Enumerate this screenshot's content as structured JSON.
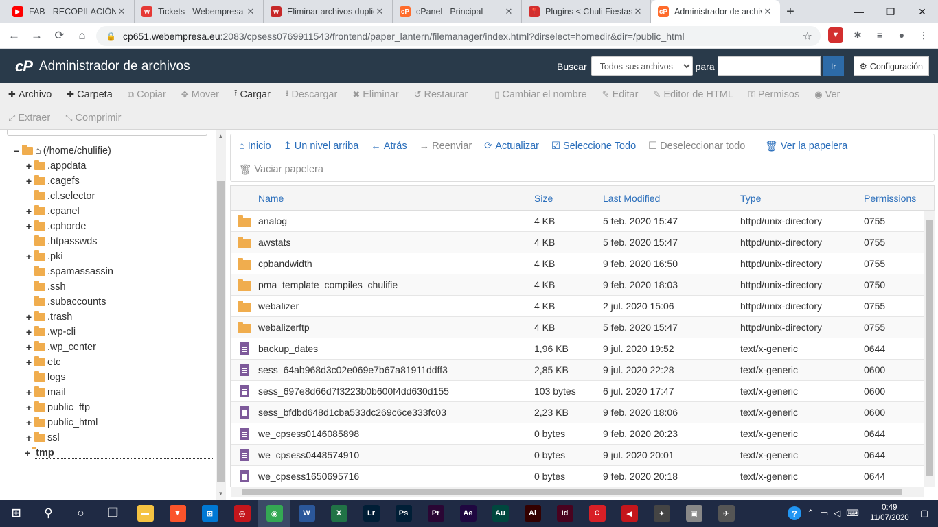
{
  "browser": {
    "tabs": [
      {
        "title": "FAB - RECOPILACIÓN -",
        "favicon": "youtube-icon",
        "color": "#ff0000",
        "glyph": "▶"
      },
      {
        "title": "Tickets - Webempresa E",
        "favicon": "webempresa-icon",
        "color": "#e53935",
        "glyph": "w"
      },
      {
        "title": "Eliminar archivos duplic",
        "favicon": "webempresa-icon",
        "color": "#c62828",
        "glyph": "w"
      },
      {
        "title": "cPanel - Principal",
        "favicon": "cpanel-icon",
        "color": "#ff6c2c",
        "glyph": "cP"
      },
      {
        "title": "Plugins < Chuli Fiestas",
        "favicon": "pin-icon",
        "color": "#d32f2f",
        "glyph": "📍"
      },
      {
        "title": "Administrador de archiv",
        "favicon": "cpanel-icon",
        "color": "#ff6c2c",
        "glyph": "cP"
      }
    ],
    "url_host": "cp651.webempresa.eu",
    "url_path": ":2083/cpsess0769911543/frontend/paper_lantern/filemanager/index.html?dirselect=homedir&dir=/public_html"
  },
  "header": {
    "logo": "cP",
    "title": "Administrador de archivos",
    "search_label": "Buscar",
    "search_scope": "Todos sus archivos",
    "para_label": "para",
    "go_label": "Ir",
    "config_label": "Configuración"
  },
  "toolbar": {
    "row1": [
      {
        "label": "Archivo",
        "icon": "plus-icon",
        "glyph": "✚",
        "enabled": true
      },
      {
        "label": "Carpeta",
        "icon": "plus-icon",
        "glyph": "✚",
        "enabled": true
      },
      {
        "label": "Copiar",
        "icon": "copy-icon",
        "glyph": "⧉",
        "enabled": false
      },
      {
        "label": "Mover",
        "icon": "move-icon",
        "glyph": "✥",
        "enabled": false
      },
      {
        "label": "Cargar",
        "icon": "upload-icon",
        "glyph": "⭱",
        "enabled": true
      },
      {
        "label": "Descargar",
        "icon": "download-icon",
        "glyph": "⭳",
        "enabled": false
      },
      {
        "label": "Eliminar",
        "icon": "delete-icon",
        "glyph": "✖",
        "enabled": false
      },
      {
        "label": "Restaurar",
        "icon": "restore-icon",
        "glyph": "↺",
        "enabled": false
      },
      {
        "sep": true
      },
      {
        "label": "Cambiar el nombre",
        "icon": "rename-icon",
        "glyph": "▯",
        "enabled": false
      },
      {
        "label": "Editar",
        "icon": "pencil-icon",
        "glyph": "✎",
        "enabled": false
      },
      {
        "label": "Editor de HTML",
        "icon": "html-editor-icon",
        "glyph": "✎",
        "enabled": false
      },
      {
        "label": "Permisos",
        "icon": "key-icon",
        "glyph": "⚿",
        "enabled": false
      },
      {
        "label": "Ver",
        "icon": "eye-icon",
        "glyph": "◉",
        "enabled": false
      }
    ],
    "row2": [
      {
        "label": "Extraer",
        "icon": "expand-icon",
        "glyph": "⤢",
        "enabled": false
      },
      {
        "label": "Comprimir",
        "icon": "compress-icon",
        "glyph": "⤡",
        "enabled": false
      }
    ]
  },
  "tree": {
    "root": "(/home/chulifie)",
    "items": [
      {
        "label": ".appdata",
        "expandable": true
      },
      {
        "label": ".cagefs",
        "expandable": true
      },
      {
        "label": ".cl.selector",
        "expandable": false
      },
      {
        "label": ".cpanel",
        "expandable": true
      },
      {
        "label": ".cphorde",
        "expandable": true
      },
      {
        "label": ".htpasswds",
        "expandable": false
      },
      {
        "label": ".pki",
        "expandable": true
      },
      {
        "label": ".spamassassin",
        "expandable": false
      },
      {
        "label": ".ssh",
        "expandable": false
      },
      {
        "label": ".subaccounts",
        "expandable": false
      },
      {
        "label": ".trash",
        "expandable": true
      },
      {
        "label": ".wp-cli",
        "expandable": true
      },
      {
        "label": ".wp_center",
        "expandable": true
      },
      {
        "label": "etc",
        "expandable": true
      },
      {
        "label": "logs",
        "expandable": false
      },
      {
        "label": "mail",
        "expandable": true
      },
      {
        "label": "public_ftp",
        "expandable": true
      },
      {
        "label": "public_html",
        "expandable": true
      },
      {
        "label": "ssl",
        "expandable": true
      },
      {
        "label": "tmp",
        "expandable": true,
        "selected": true
      }
    ]
  },
  "nav": {
    "row1": [
      {
        "label": "Inicio",
        "icon": "home-icon",
        "glyph": "⌂",
        "enabled": true
      },
      {
        "label": "Un nivel arriba",
        "icon": "level-up-icon",
        "glyph": "↥",
        "enabled": true
      },
      {
        "label": "Atrás",
        "icon": "back-arrow-icon",
        "glyph": "←",
        "enabled": true
      },
      {
        "label": "Reenviar",
        "icon": "forward-arrow-icon",
        "glyph": "→",
        "enabled": false
      },
      {
        "label": "Actualizar",
        "icon": "refresh-icon",
        "glyph": "⟳",
        "enabled": true
      },
      {
        "label": "Seleccione Todo",
        "icon": "checkbox-checked-icon",
        "glyph": "☑",
        "enabled": true
      },
      {
        "label": "Deseleccionar todo",
        "icon": "checkbox-empty-icon",
        "glyph": "☐",
        "enabled": false
      },
      {
        "sep": true
      },
      {
        "label": "Ver la papelera",
        "icon": "trash-icon",
        "glyph": "🗑",
        "enabled": true
      }
    ],
    "row2": [
      {
        "label": "Vaciar papelera",
        "icon": "trash-icon",
        "glyph": "🗑",
        "enabled": false
      }
    ]
  },
  "table": {
    "headers": {
      "name": "Name",
      "size": "Size",
      "modified": "Last Modified",
      "type": "Type",
      "perms": "Permissions"
    },
    "rows": [
      {
        "kind": "dir",
        "name": "analog",
        "size": "4 KB",
        "modified": "5 feb. 2020 15:47",
        "type": "httpd/unix-directory",
        "perms": "0755"
      },
      {
        "kind": "dir",
        "name": "awstats",
        "size": "4 KB",
        "modified": "5 feb. 2020 15:47",
        "type": "httpd/unix-directory",
        "perms": "0755"
      },
      {
        "kind": "dir",
        "name": "cpbandwidth",
        "size": "4 KB",
        "modified": "9 feb. 2020 16:50",
        "type": "httpd/unix-directory",
        "perms": "0755"
      },
      {
        "kind": "dir",
        "name": "pma_template_compiles_chulifie",
        "size": "4 KB",
        "modified": "9 feb. 2020 18:03",
        "type": "httpd/unix-directory",
        "perms": "0750"
      },
      {
        "kind": "dir",
        "name": "webalizer",
        "size": "4 KB",
        "modified": "2 jul. 2020 15:06",
        "type": "httpd/unix-directory",
        "perms": "0755"
      },
      {
        "kind": "dir",
        "name": "webalizerftp",
        "size": "4 KB",
        "modified": "5 feb. 2020 15:47",
        "type": "httpd/unix-directory",
        "perms": "0755"
      },
      {
        "kind": "file",
        "name": "backup_dates",
        "size": "1,96 KB",
        "modified": "9 jul. 2020 19:52",
        "type": "text/x-generic",
        "perms": "0644"
      },
      {
        "kind": "file",
        "name": "sess_64ab968d3c02e069e7b67a81911ddff3",
        "size": "2,85 KB",
        "modified": "9 jul. 2020 22:28",
        "type": "text/x-generic",
        "perms": "0600"
      },
      {
        "kind": "file",
        "name": "sess_697e8d66d7f3223b0b600f4dd630d155",
        "size": "103 bytes",
        "modified": "6 jul. 2020 17:47",
        "type": "text/x-generic",
        "perms": "0600"
      },
      {
        "kind": "file",
        "name": "sess_bfdbd648d1cba533dc269c6ce333fc03",
        "size": "2,23 KB",
        "modified": "9 feb. 2020 18:06",
        "type": "text/x-generic",
        "perms": "0600"
      },
      {
        "kind": "file",
        "name": "we_cpsess0146085898",
        "size": "0 bytes",
        "modified": "9 feb. 2020 20:23",
        "type": "text/x-generic",
        "perms": "0644"
      },
      {
        "kind": "file",
        "name": "we_cpsess0448574910",
        "size": "0 bytes",
        "modified": "9 jul. 2020 20:01",
        "type": "text/x-generic",
        "perms": "0644"
      },
      {
        "kind": "file",
        "name": "we_cpsess1650695716",
        "size": "0 bytes",
        "modified": "9 feb. 2020 20:18",
        "type": "text/x-generic",
        "perms": "0644"
      }
    ]
  },
  "taskbar": {
    "apps": [
      {
        "name": "windows-start-icon",
        "glyph": "⊞",
        "color": "transparent"
      },
      {
        "name": "search-icon",
        "glyph": "⚲",
        "color": "transparent"
      },
      {
        "name": "cortana-icon",
        "glyph": "○",
        "color": "transparent"
      },
      {
        "name": "task-view-icon",
        "glyph": "❐",
        "color": "transparent"
      },
      {
        "name": "file-explorer-icon",
        "glyph": "▬",
        "color": "#f5c342"
      },
      {
        "name": "brave-icon",
        "glyph": "▼",
        "color": "#fb542b"
      },
      {
        "name": "store-icon",
        "glyph": "⊞",
        "color": "#0078d4"
      },
      {
        "name": "app-red-icon",
        "glyph": "◎",
        "color": "#c4161c"
      },
      {
        "name": "chrome-icon",
        "glyph": "◉",
        "color": "#34a853",
        "active": true
      },
      {
        "name": "word-icon",
        "glyph": "W",
        "color": "#2b579a"
      },
      {
        "name": "excel-icon",
        "glyph": "X",
        "color": "#217346"
      },
      {
        "name": "lightroom-icon",
        "glyph": "Lr",
        "color": "#001e36"
      },
      {
        "name": "photoshop-icon",
        "glyph": "Ps",
        "color": "#001e36"
      },
      {
        "name": "premiere-icon",
        "glyph": "Pr",
        "color": "#2a0634"
      },
      {
        "name": "after-effects-icon",
        "glyph": "Ae",
        "color": "#1f0740"
      },
      {
        "name": "audition-icon",
        "glyph": "Au",
        "color": "#00473e"
      },
      {
        "name": "illustrator-icon",
        "glyph": "Ai",
        "color": "#330000"
      },
      {
        "name": "indesign-icon",
        "glyph": "Id",
        "color": "#49021f"
      },
      {
        "name": "app-c-icon",
        "glyph": "C",
        "color": "#d81f26"
      },
      {
        "name": "app-arrow-icon",
        "glyph": "◀",
        "color": "#c4161c"
      },
      {
        "name": "app-owl-icon",
        "glyph": "✦",
        "color": "#444"
      },
      {
        "name": "app-folder-icon",
        "glyph": "▣",
        "color": "#888"
      },
      {
        "name": "app-tool-icon",
        "glyph": "✈",
        "color": "#555"
      }
    ],
    "time": "0:49",
    "date": "11/07/2020"
  }
}
